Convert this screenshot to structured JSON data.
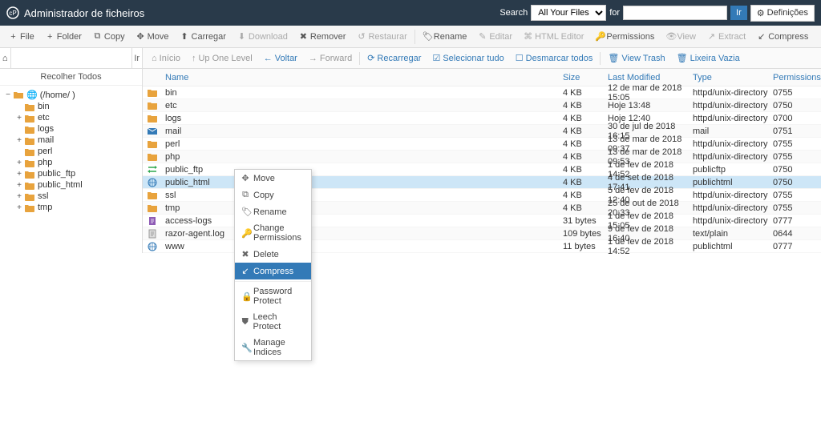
{
  "header": {
    "title": "Administrador de ficheiros",
    "search_label": "Search",
    "search_scope": "All Your Files",
    "for_label": "for",
    "go": "Ir",
    "settings": "Definições"
  },
  "toolbar": {
    "file": "File",
    "folder": "Folder",
    "copy": "Copy",
    "move": "Move",
    "upload": "Carregar",
    "download": "Download",
    "remove": "Remover",
    "restore": "Restaurar",
    "rename": "Rename",
    "edit": "Editar",
    "html_editor": "HTML Editor",
    "permissions": "Permissions",
    "view": "View",
    "extract": "Extract",
    "compress": "Compress"
  },
  "sidebar": {
    "go": "Ir",
    "collapse": "Recolher Todos",
    "root": "(/home/   )",
    "items": [
      {
        "label": "bin",
        "toggle": ""
      },
      {
        "label": "etc",
        "toggle": "+"
      },
      {
        "label": "logs",
        "toggle": ""
      },
      {
        "label": "mail",
        "toggle": "+"
      },
      {
        "label": "perl",
        "toggle": ""
      },
      {
        "label": "php",
        "toggle": "+"
      },
      {
        "label": "public_ftp",
        "toggle": "+"
      },
      {
        "label": "public_html",
        "toggle": "+"
      },
      {
        "label": "ssl",
        "toggle": "+"
      },
      {
        "label": "tmp",
        "toggle": "+"
      }
    ]
  },
  "navbar": {
    "home": "Início",
    "up": "Up One Level",
    "back": "Voltar",
    "forward": "Forward",
    "reload": "Recarregar",
    "select_all": "Selecionar tudo",
    "unselect_all": "Desmarcar todos",
    "view_trash": "View Trash",
    "empty_trash": "Lixeira Vazia"
  },
  "columns": {
    "name": "Name",
    "size": "Size",
    "modified": "Last Modified",
    "type": "Type",
    "permissions": "Permissions"
  },
  "rows": [
    {
      "icon": "folder",
      "name": "bin",
      "size": "4 KB",
      "mod": "12 de mar de 2018 15:05",
      "type": "httpd/unix-directory",
      "perm": "0755"
    },
    {
      "icon": "folder",
      "name": "etc",
      "size": "4 KB",
      "mod": "Hoje 13:48",
      "type": "httpd/unix-directory",
      "perm": "0750"
    },
    {
      "icon": "folder",
      "name": "logs",
      "size": "4 KB",
      "mod": "Hoje 12:40",
      "type": "httpd/unix-directory",
      "perm": "0700"
    },
    {
      "icon": "mail",
      "name": "mail",
      "size": "4 KB",
      "mod": "30 de jul de 2018 16:15",
      "type": "mail",
      "perm": "0751"
    },
    {
      "icon": "folder",
      "name": "perl",
      "size": "4 KB",
      "mod": "13 de mar de 2018 09:37",
      "type": "httpd/unix-directory",
      "perm": "0755"
    },
    {
      "icon": "folder",
      "name": "php",
      "size": "4 KB",
      "mod": "13 de mar de 2018 09:53",
      "type": "httpd/unix-directory",
      "perm": "0755"
    },
    {
      "icon": "ftp",
      "name": "public_ftp",
      "size": "4 KB",
      "mod": "1 de fev de 2018 14:52",
      "type": "publicftp",
      "perm": "0750"
    },
    {
      "icon": "globe",
      "name": "public_html",
      "size": "4 KB",
      "mod": "4 de set de 2018 17:41",
      "type": "publichtml",
      "perm": "0750",
      "selected": true
    },
    {
      "icon": "folder",
      "name": "ssl",
      "size": "4 KB",
      "mod": "5 de fev de 2018 12:40",
      "type": "httpd/unix-directory",
      "perm": "0755"
    },
    {
      "icon": "folder",
      "name": "tmp",
      "size": "4 KB",
      "mod": "25 de out de 2018 20:33",
      "type": "httpd/unix-directory",
      "perm": "0755"
    },
    {
      "icon": "file-script",
      "name": "access-logs",
      "size": "31 bytes",
      "mod": "1 de fev de 2018 15:05",
      "type": "httpd/unix-directory",
      "perm": "0777"
    },
    {
      "icon": "file-text",
      "name": "razor-agent.log",
      "size": "109 bytes",
      "mod": "9 de fev de 2018 16:40",
      "type": "text/plain",
      "perm": "0644"
    },
    {
      "icon": "globe-link",
      "name": "www",
      "size": "11 bytes",
      "mod": "1 de fev de 2018 14:52",
      "type": "publichtml",
      "perm": "0777"
    }
  ],
  "context": {
    "move": "Move",
    "copy": "Copy",
    "rename": "Rename",
    "change_permissions": "Change Permissions",
    "delete": "Delete",
    "compress": "Compress",
    "password_protect": "Password Protect",
    "leech_protect": "Leech Protect",
    "manage_indices": "Manage Indices"
  }
}
